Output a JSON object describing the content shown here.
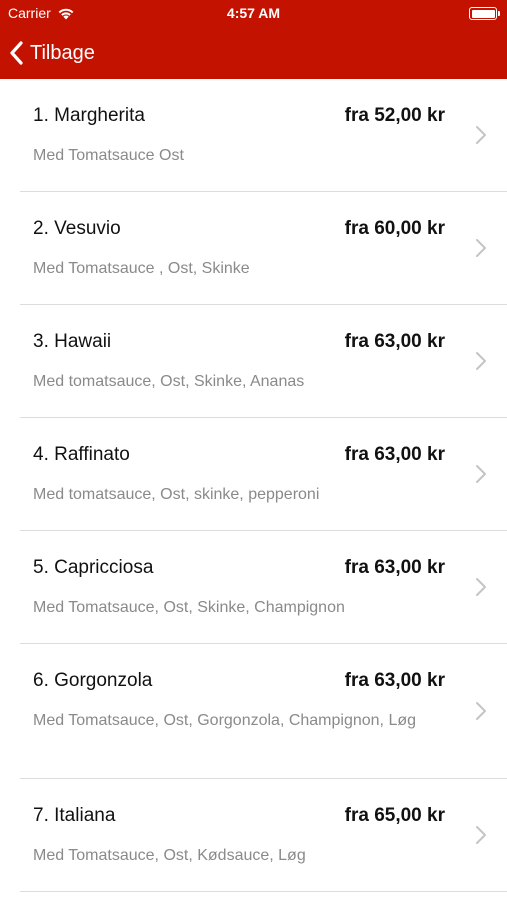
{
  "status_bar": {
    "carrier": "Carrier",
    "time": "4:57 AM"
  },
  "nav": {
    "back_label": "Tilbage"
  },
  "menu": [
    {
      "name": "1. Margherita",
      "price": "fra 52,00 kr",
      "description": "Med Tomatsauce Ost"
    },
    {
      "name": "2. Vesuvio",
      "price": "fra 60,00 kr",
      "description": "Med Tomatsauce , Ost, Skinke"
    },
    {
      "name": "3. Hawaii",
      "price": "fra 63,00 kr",
      "description": "Med tomatsauce, Ost, Skinke, Ananas"
    },
    {
      "name": "4. Raffinato",
      "price": "fra 63,00 kr",
      "description": "Med tomatsauce, Ost, skinke, pepperoni"
    },
    {
      "name": "5. Capricciosa",
      "price": "fra 63,00 kr",
      "description": "Med Tomatsauce, Ost, Skinke, Champignon"
    },
    {
      "name": "6. Gorgonzola",
      "price": "fra 63,00 kr",
      "description": "Med Tomatsauce, Ost, Gorgonzola, Champignon, Løg"
    },
    {
      "name": "7. Italiana",
      "price": "fra 65,00 kr",
      "description": "Med Tomatsauce, Ost, Kødsauce, Løg"
    }
  ],
  "colors": {
    "accent": "#c41200",
    "text": "#111111",
    "subtext": "#8a8a8a",
    "separator": "#dcdcdc"
  }
}
